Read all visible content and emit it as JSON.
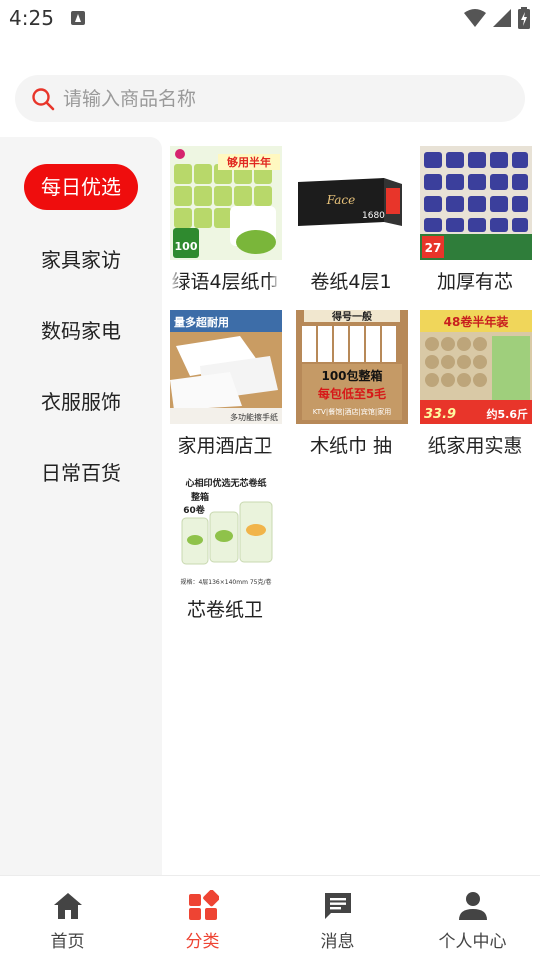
{
  "status_bar": {
    "time": "4:25",
    "icons": [
      "notification-a-icon",
      "wifi-icon",
      "signal-icon",
      "battery-charging-icon"
    ]
  },
  "search": {
    "placeholder": "请输入商品名称",
    "value": "",
    "icon": "search-icon",
    "accent_color": "#e8352a"
  },
  "sidebar": {
    "active_color": "#ef0d0d",
    "items": [
      {
        "label": "每日优选",
        "active": true
      },
      {
        "label": "家具家访",
        "active": false
      },
      {
        "label": "数码家电",
        "active": false
      },
      {
        "label": "衣服服饰",
        "active": false
      },
      {
        "label": "日常百货",
        "active": false
      }
    ]
  },
  "products": [
    {
      "name": "绿语4层纸巾",
      "badge": "够用半年",
      "count_label": "100"
    },
    {
      "name": "卷纸4层1",
      "brand": "Face",
      "count_label": "1680"
    },
    {
      "name": "加厚有芯",
      "count_label": "27"
    },
    {
      "name": "家用酒店卫",
      "promo": "量多超耐用",
      "usage": "多功能擦手纸"
    },
    {
      "name": "木纸巾 抽",
      "top_label": "得号一般",
      "promo": "100包整箱",
      "promo2": "每包低至5毛",
      "usage": "KTV|餐馆|酒店|宾馆|家用"
    },
    {
      "name": "纸家用实惠",
      "badge": "48卷半年装",
      "price": "33.9",
      "weight": "约5.6斤"
    },
    {
      "name": "芯卷纸卫",
      "title": "心相印优选无芯卷纸",
      "pack": "整箱",
      "count": "60卷",
      "spec": "规格：4层136×140mm 75克/卷"
    }
  ],
  "bottom_nav": {
    "active_color": "#ee4433",
    "items": [
      {
        "label": "首页",
        "icon": "home-icon",
        "active": false
      },
      {
        "label": "分类",
        "icon": "category-icon",
        "active": true
      },
      {
        "label": "消息",
        "icon": "message-icon",
        "active": false
      },
      {
        "label": "个人中心",
        "icon": "person-icon",
        "active": false
      }
    ]
  }
}
